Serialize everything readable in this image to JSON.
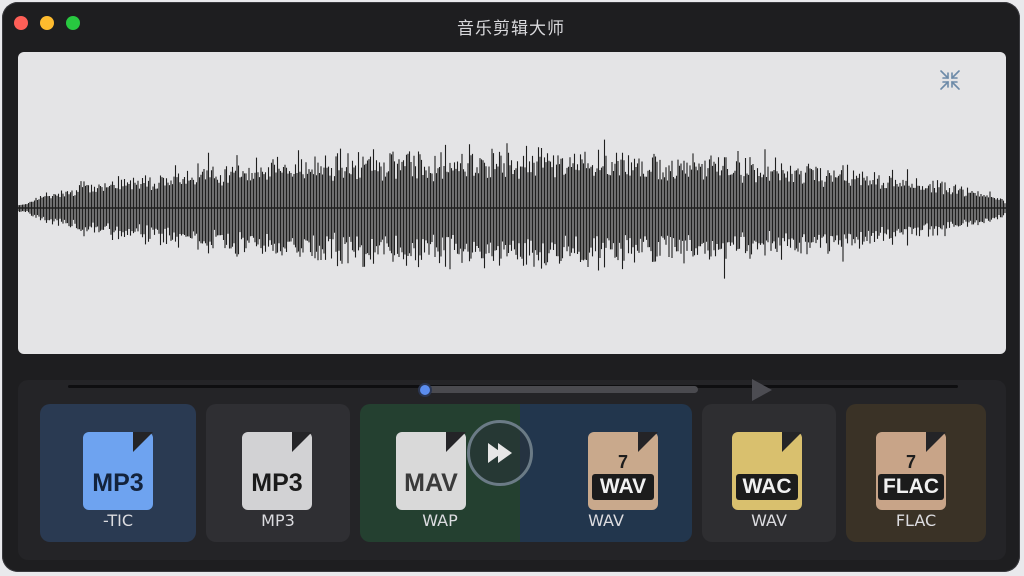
{
  "window": {
    "title": "音乐剪辑大师"
  },
  "waveform": {
    "panel_color": "#e4e4e6",
    "wave_color": "#1f1f1f"
  },
  "transport": {
    "progress": 0.43
  },
  "formats": [
    {
      "icon_text": "MP3",
      "label": "-TIC",
      "tile_color": "#2a3a52",
      "icon_color": "#6ea3f0"
    },
    {
      "icon_text": "MP3",
      "label": "MP3",
      "tile_color": "#2f2f33",
      "icon_color": "#d2d2d4"
    },
    {
      "icon_text": "MAV",
      "label": "WAP",
      "tile_color": "#244030",
      "icon_color": "#d9d9d9"
    },
    {
      "icon_text": "WAV",
      "icon_num": "7",
      "label": "WAV",
      "tile_color": "#22364d",
      "icon_color": "#c9a98c"
    },
    {
      "icon_text": "WAC",
      "label": "WAV",
      "tile_color": "#2e2e31",
      "icon_color": "#d9c06e"
    },
    {
      "icon_text": "FLAC",
      "icon_num": "7",
      "label": "FLAC",
      "tile_color": "#3a3226",
      "icon_color": "#c8a488"
    }
  ]
}
